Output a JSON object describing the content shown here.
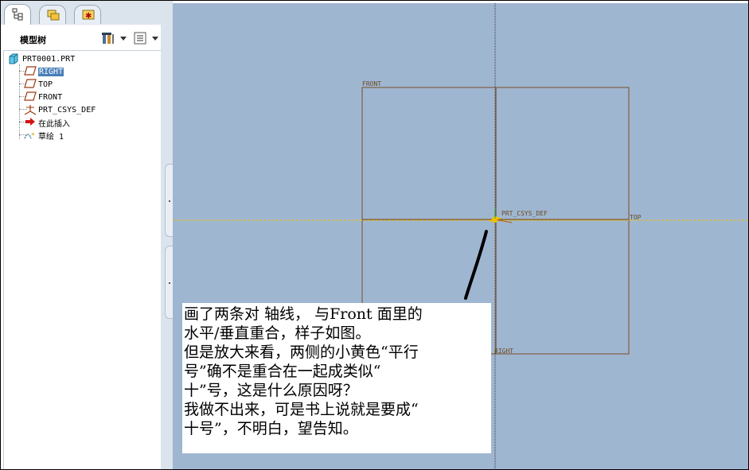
{
  "model_tree": {
    "title": "模型树",
    "tabs": [
      {
        "icon": "model-tree-tab-icon",
        "active": true
      },
      {
        "icon": "folder-browser-tab-icon",
        "active": false
      },
      {
        "icon": "favorites-tab-icon",
        "active": false
      }
    ],
    "header_buttons": [
      {
        "icon": "settings-tools-icon"
      },
      {
        "icon": "show-columns-icon"
      }
    ],
    "root": {
      "label": "PRT0001.PRT",
      "icon": "part-icon"
    },
    "items": [
      {
        "label": "RIGHT",
        "icon": "datum-plane-icon",
        "selected": true
      },
      {
        "label": "TOP",
        "icon": "datum-plane-icon",
        "selected": false
      },
      {
        "label": "FRONT",
        "icon": "datum-plane-icon",
        "selected": false
      },
      {
        "label": "PRT_CSYS_DEF",
        "icon": "coordinate-system-icon",
        "selected": false
      },
      {
        "label": "在此插入",
        "icon": "insert-here-arrow-icon",
        "selected": false
      },
      {
        "label": "草绘 1",
        "icon": "sketch-icon",
        "selected": false
      }
    ]
  },
  "graphics": {
    "datum_labels": {
      "front": "FRONT",
      "top": "TOP",
      "right": "RIGHT",
      "csys": "PRT_CSYS_DEF"
    },
    "colors": {
      "background": "#9fb6d1",
      "datum_outline": "#7a4f22",
      "sketch_axis": "#f2c200"
    }
  },
  "note": {
    "lines": [
      "画了两条对 轴线，  与Front 面里的",
      "水平/垂直重合，样子如图。",
      "但是放大来看，两侧的小黄色“平行",
      "号”确不是重合在一起成类似“",
      "十”号，这是什么原因呀？",
      "我做不出来，可是书上说就是要成“",
      "十号”，不明白，望告知。"
    ]
  }
}
